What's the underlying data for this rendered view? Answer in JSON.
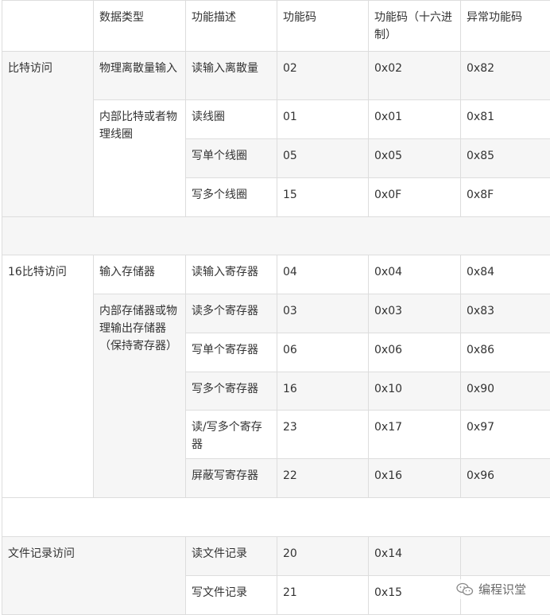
{
  "header": {
    "data_type": "数据类型",
    "description": "功能描述",
    "code": "功能码",
    "hex_code": "功能码（十六进制）",
    "exception_code": "异常功能码"
  },
  "bit_access": {
    "group": "比特访问",
    "discrete_inputs": "物理离散量输入",
    "coils": "内部比特或者物理线圈",
    "rows": [
      {
        "desc": "读输入离散量",
        "code": "02",
        "hex": "0x02",
        "exc": "0x82"
      },
      {
        "desc": "读线圈",
        "code": "01",
        "hex": "0x01",
        "exc": "0x81"
      },
      {
        "desc": "写单个线圈",
        "code": "05",
        "hex": "0x05",
        "exc": "0x85"
      },
      {
        "desc": "写多个线圈",
        "code": "15",
        "hex": "0x0F",
        "exc": "0x8F"
      }
    ]
  },
  "word_access": {
    "group": "16比特访问",
    "input_registers": "输入存储器",
    "holding_registers": "内部存储器或物理输出存储器（保持寄存器）",
    "rows": [
      {
        "desc": "读输入寄存器",
        "code": "04",
        "hex": "0x04",
        "exc": "0x84"
      },
      {
        "desc": "读多个寄存器",
        "code": "03",
        "hex": "0x03",
        "exc": "0x83"
      },
      {
        "desc": "写单个寄存器",
        "code": "06",
        "hex": "0x06",
        "exc": "0x86"
      },
      {
        "desc": "写多个寄存器",
        "code": "16",
        "hex": "0x10",
        "exc": "0x90"
      },
      {
        "desc": "读/写多个寄存器",
        "code": "23",
        "hex": "0x17",
        "exc": "0x97"
      },
      {
        "desc": "屏蔽写寄存器",
        "code": "22",
        "hex": "0x16",
        "exc": "0x96"
      }
    ]
  },
  "file_access": {
    "group": "文件记录访问",
    "rows": [
      {
        "desc": "读文件记录",
        "code": "20",
        "hex": "0x14"
      },
      {
        "desc": "写文件记录",
        "code": "21",
        "hex": "0x15"
      }
    ]
  },
  "watermark": {
    "icon": "wechat-icon",
    "text": "编程识堂"
  }
}
